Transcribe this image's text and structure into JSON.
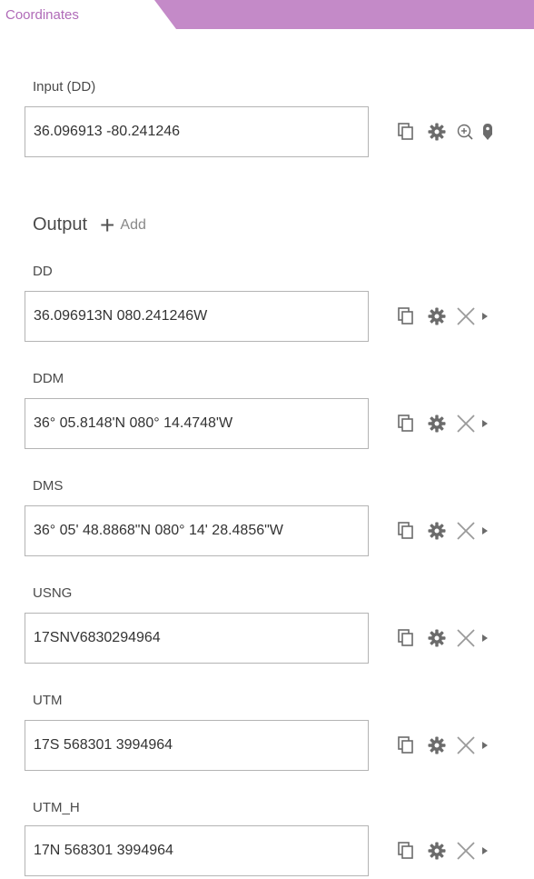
{
  "tabs": {
    "active_label": "Coordinates"
  },
  "input": {
    "label": "Input (DD)",
    "value": "36.096913 -80.241246"
  },
  "output": {
    "heading": "Output",
    "add_label": "Add",
    "rows": [
      {
        "label": "DD",
        "value": "36.096913N 080.241246W"
      },
      {
        "label": "DDM",
        "value": "36° 05.8148'N 080° 14.4748'W"
      },
      {
        "label": "DMS",
        "value": "36° 05' 48.8868\"N 080° 14' 28.4856\"W"
      },
      {
        "label": "USNG",
        "value": "17SNV6830294964"
      },
      {
        "label": "UTM",
        "value": "17S 568301 3994964"
      },
      {
        "label": "UTM_H",
        "value": "17N 568301 3994964"
      }
    ]
  },
  "icons": {
    "copy": "copy-icon",
    "settings": "gear-icon",
    "zoom": "zoom-in-icon",
    "pin": "map-pin-icon",
    "remove": "close-icon",
    "expand": "caret-right-icon"
  },
  "colors": {
    "tab_accent": "#c48ac8",
    "tab_text": "#b06bb8",
    "icon": "#6b6b6b",
    "border": "#b4b4b4"
  }
}
